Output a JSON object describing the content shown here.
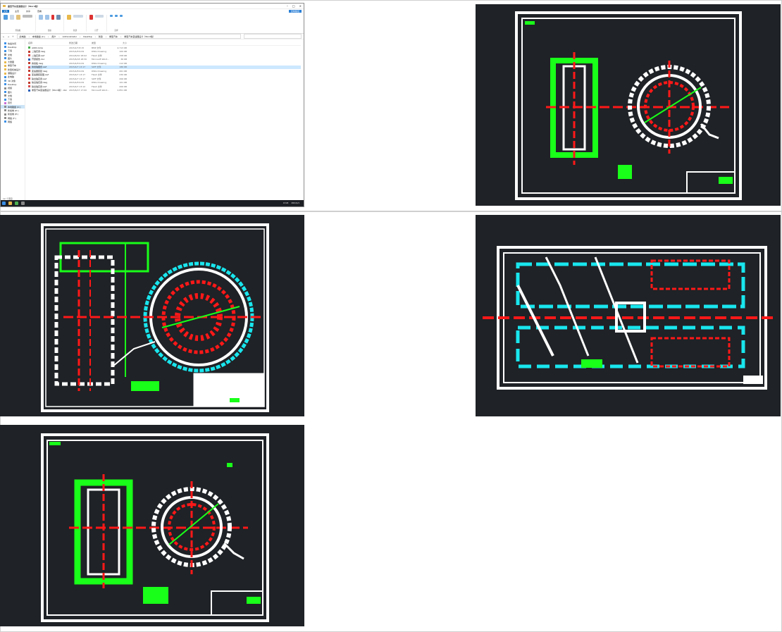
{
  "explorer": {
    "title": "重型汽车变速器设计（Word版）",
    "menu": {
      "file": "文件",
      "home": "主页",
      "share": "共享",
      "view": "查看"
    },
    "help_label": "复制路径",
    "ribbon_groups": [
      "剪贴板",
      "组织",
      "新建",
      "打开",
      "选择"
    ],
    "address": [
      "此电脑",
      "本地磁盘 (C:)",
      "用户",
      "Administrator",
      "Desktop",
      "新建",
      "重型汽车",
      "重型汽车变速器设计（Word版）"
    ],
    "columns": {
      "name": "名称",
      "date": "修改日期",
      "type": "类型",
      "size": "大小"
    },
    "files": [
      {
        "name": "A0DC.bmp",
        "date": "2015/2/3 8:15",
        "type": "BMP 文件",
        "size": "4,713 KB"
      },
      {
        "name": "二轴花键.dwg",
        "date": "2015/4/8 9:09",
        "type": "DWG Drawing",
        "size": "100 KB"
      },
      {
        "name": "二轴花键.swf",
        "date": "2014/6/10 18:02",
        "type": "Flash 文件",
        "size": "158 KB"
      },
      {
        "name": "开题报告.doc",
        "date": "2015/6/18 18:30",
        "type": "Microsoft Word...",
        "size": "36 KB"
      },
      {
        "name": "换挡板.dwg",
        "date": "2015/4/8 9:09",
        "type": "DWG Drawing",
        "size": "112 KB"
      },
      {
        "name": "换挡轴图纸.swf",
        "date": "2015/4/7 13:17",
        "type": "SWF 文件",
        "size": "186 KB",
        "selected": true
      },
      {
        "name": "变速器装配.dwg",
        "date": "2015/4/8 9:09",
        "type": "DWG Drawing",
        "size": "261 KB"
      },
      {
        "name": "变速器装配图.swf",
        "date": "2015/4/7 13:17",
        "type": "Flash 文件",
        "size": "230 KB"
      },
      {
        "name": "输出轴花键.swf",
        "date": "2015/4/7 13:17",
        "type": "SWF 文件",
        "size": "206 KB"
      },
      {
        "name": "输出轴花键.dwg",
        "date": "2015/4/8 9:09",
        "type": "DWG Drawing",
        "size": "101 KB"
      },
      {
        "name": "输出轴花键.swf",
        "date": "2015/4/7 13:12",
        "type": "Flash 文件",
        "size": "206 KB"
      },
      {
        "name": "重型汽车变速器设计（Word版）.doc",
        "date": "2015/6/17 17:00",
        "type": "Microsoft Word...",
        "size": "2,851 KB"
      }
    ],
    "sidebar": [
      {
        "label": "快速访问"
      },
      {
        "label": "Desktop"
      },
      {
        "label": "下载"
      },
      {
        "label": "文档"
      },
      {
        "label": "图片"
      },
      {
        "label": "大量图"
      },
      {
        "label": "重型汽车"
      },
      {
        "label": "新型机械设计"
      },
      {
        "label": "课程设计"
      },
      {
        "label": "此电脑"
      },
      {
        "label": "3D 对象"
      },
      {
        "label": "Desktop"
      },
      {
        "label": "视频"
      },
      {
        "label": "图片"
      },
      {
        "label": "文档"
      },
      {
        "label": "下载"
      },
      {
        "label": "音乐"
      },
      {
        "label": "本地磁盘 (C:)",
        "selected": true
      },
      {
        "label": "新加卷 (D:)"
      },
      {
        "label": "新加卷 (E:)"
      },
      {
        "label": "网络 (F:)"
      },
      {
        "label": "网络"
      }
    ],
    "status": "12 个项目",
    "tray_time": "13:20",
    "tray_date": "2021/1/1"
  },
  "colors": {
    "drawing_bg": "#1f2226",
    "cad_green": "#19ff19",
    "cad_red": "#ff1818",
    "cad_cyan": "#19e6ee",
    "cad_white": "#ffffff"
  }
}
